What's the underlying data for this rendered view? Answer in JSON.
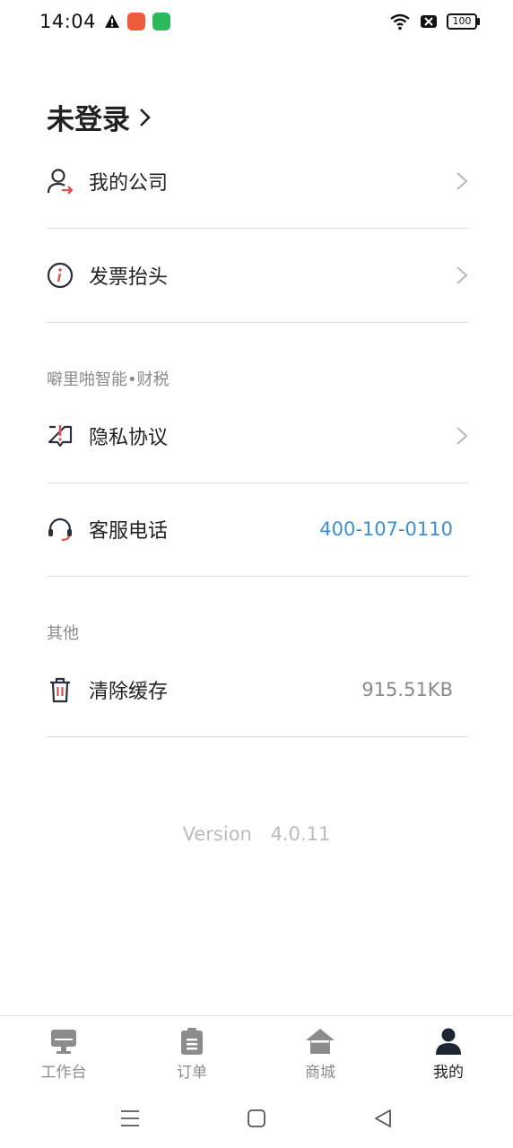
{
  "status": {
    "time": "14:04",
    "battery": "100"
  },
  "header": {
    "login_text": "未登录"
  },
  "menu": {
    "company": {
      "label": "我的公司"
    },
    "invoice": {
      "label": "发票抬头"
    },
    "section_brand": "噼里啪智能•财税",
    "privacy": {
      "label": "隐私协议"
    },
    "service": {
      "label": "客服电话",
      "value": "400-107-0110"
    },
    "section_other": "其他",
    "cache": {
      "label": "清除缓存",
      "value": "915.51KB"
    }
  },
  "version": {
    "label": "Version",
    "number": "4.0.11"
  },
  "tabs": [
    {
      "label": "工作台",
      "icon": "desktop-icon"
    },
    {
      "label": "订单",
      "icon": "clipboard-icon"
    },
    {
      "label": "商城",
      "icon": "home-icon"
    },
    {
      "label": "我的",
      "icon": "user-icon",
      "active": true
    }
  ],
  "colors": {
    "accent_blue": "#3a8fd6",
    "muted": "#8a8a8a",
    "red_accent": "#e05050"
  }
}
